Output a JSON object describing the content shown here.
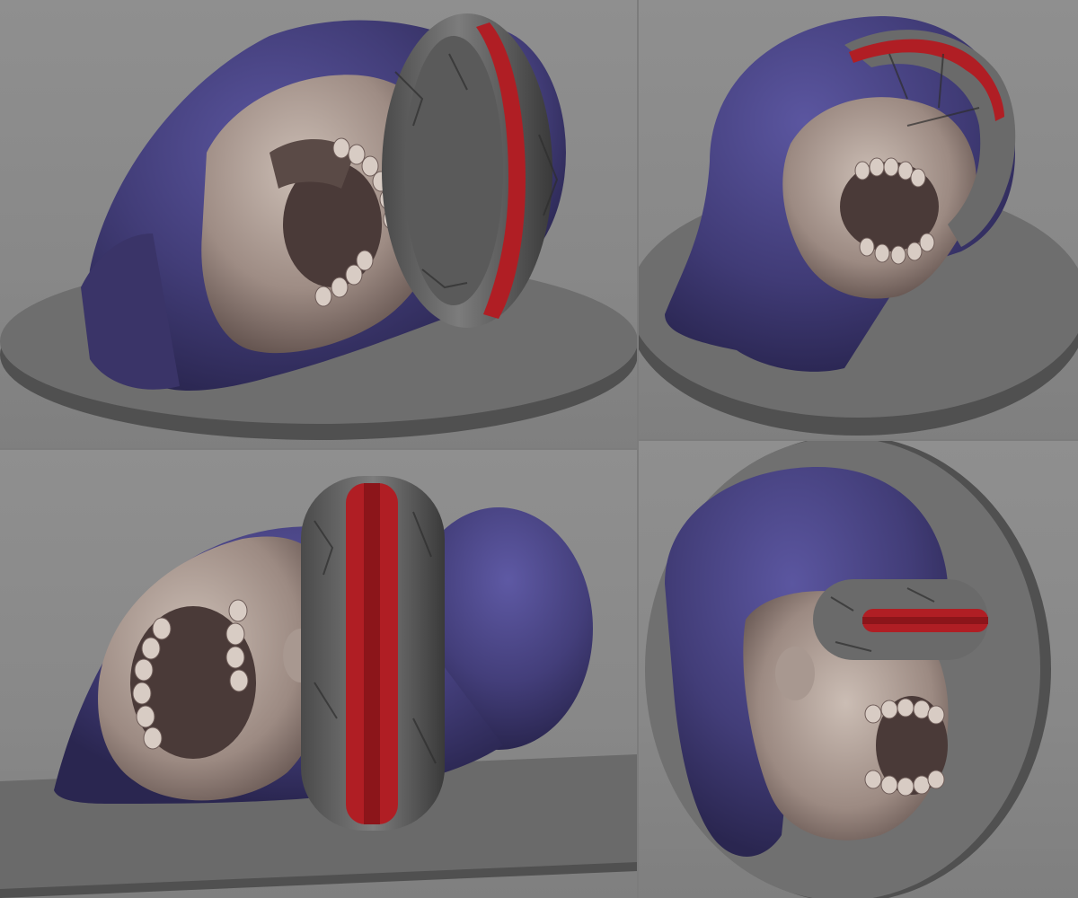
{
  "scene": {
    "subject": "skull-with-visor",
    "views": [
      "three-quarter-left",
      "three-quarter-right",
      "side-left",
      "side-right"
    ]
  },
  "colors": {
    "background": "#8a8a8a",
    "pedestal_top": "#6e6e6e",
    "pedestal_side": "#505050",
    "hood": "#4a4580",
    "hood_shadow": "#2e2a55",
    "hood_rust": "#6b4a4a",
    "bone": "#b8a8a0",
    "bone_shadow": "#6e5c58",
    "visor": "#6a6a6a",
    "visor_dark": "#3c3c3c",
    "visor_stripe": "#b01e24"
  }
}
